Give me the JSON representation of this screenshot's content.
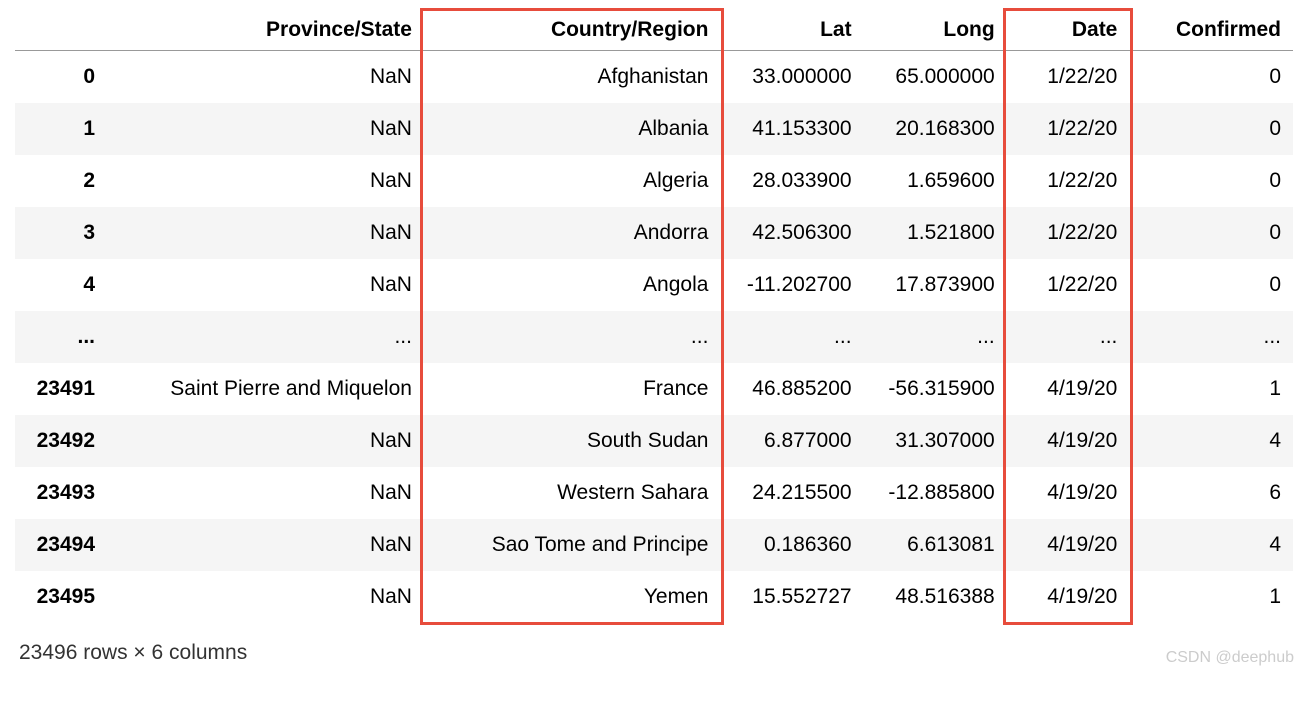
{
  "columns": {
    "index": "",
    "province_state": "Province/State",
    "country_region": "Country/Region",
    "lat": "Lat",
    "long": "Long",
    "date": "Date",
    "confirmed": "Confirmed"
  },
  "rows": [
    {
      "index": "0",
      "ps": "NaN",
      "cr": "Afghanistan",
      "lat": "33.000000",
      "long": "65.000000",
      "date": "1/22/20",
      "conf": "0"
    },
    {
      "index": "1",
      "ps": "NaN",
      "cr": "Albania",
      "lat": "41.153300",
      "long": "20.168300",
      "date": "1/22/20",
      "conf": "0"
    },
    {
      "index": "2",
      "ps": "NaN",
      "cr": "Algeria",
      "lat": "28.033900",
      "long": "1.659600",
      "date": "1/22/20",
      "conf": "0"
    },
    {
      "index": "3",
      "ps": "NaN",
      "cr": "Andorra",
      "lat": "42.506300",
      "long": "1.521800",
      "date": "1/22/20",
      "conf": "0"
    },
    {
      "index": "4",
      "ps": "NaN",
      "cr": "Angola",
      "lat": "-11.202700",
      "long": "17.873900",
      "date": "1/22/20",
      "conf": "0"
    },
    {
      "index": "...",
      "ps": "...",
      "cr": "...",
      "lat": "...",
      "long": "...",
      "date": "...",
      "conf": "..."
    },
    {
      "index": "23491",
      "ps": "Saint Pierre and Miquelon",
      "cr": "France",
      "lat": "46.885200",
      "long": "-56.315900",
      "date": "4/19/20",
      "conf": "1"
    },
    {
      "index": "23492",
      "ps": "NaN",
      "cr": "South Sudan",
      "lat": "6.877000",
      "long": "31.307000",
      "date": "4/19/20",
      "conf": "4"
    },
    {
      "index": "23493",
      "ps": "NaN",
      "cr": "Western Sahara",
      "lat": "24.215500",
      "long": "-12.885800",
      "date": "4/19/20",
      "conf": "6"
    },
    {
      "index": "23494",
      "ps": "NaN",
      "cr": "Sao Tome and Principe",
      "lat": "0.186360",
      "long": "6.613081",
      "date": "4/19/20",
      "conf": "4"
    },
    {
      "index": "23495",
      "ps": "NaN",
      "cr": "Yemen",
      "lat": "15.552727",
      "long": "48.516388",
      "date": "4/19/20",
      "conf": "1"
    }
  ],
  "footer": "23496 rows × 6 columns",
  "watermark": "CSDN @deephub"
}
